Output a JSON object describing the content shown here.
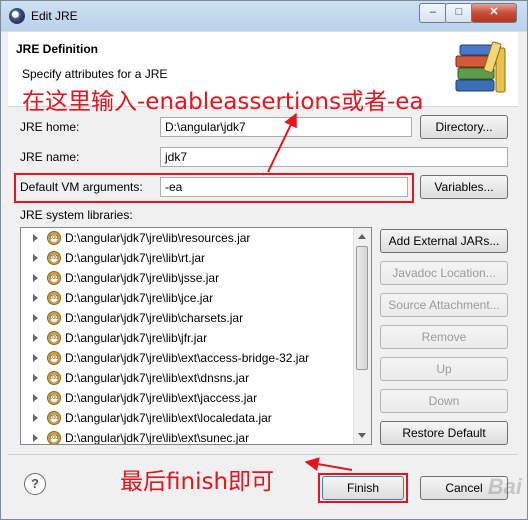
{
  "window": {
    "title": "Edit JRE",
    "minimize_glyph": "–",
    "maximize_glyph": "□",
    "close_glyph": "✕"
  },
  "header": {
    "section_title": "JRE Definition",
    "description": "Specify attributes for a JRE"
  },
  "annotations": {
    "top": "在这里输入-enableassertions或者-ea",
    "bottom": "最后finish即可",
    "color": "#e6141e"
  },
  "form": {
    "jre_home_label": "JRE home:",
    "jre_home_value": "D:\\angular\\jdk7",
    "directory_button": "Directory...",
    "jre_name_label": "JRE name:",
    "jre_name_value": "jdk7",
    "vm_args_label": "Default VM arguments:",
    "vm_args_value": "-ea",
    "variables_button": "Variables..."
  },
  "libraries": {
    "label": "JRE system libraries:",
    "items": [
      "D:\\angular\\jdk7\\jre\\lib\\resources.jar",
      "D:\\angular\\jdk7\\jre\\lib\\rt.jar",
      "D:\\angular\\jdk7\\jre\\lib\\jsse.jar",
      "D:\\angular\\jdk7\\jre\\lib\\jce.jar",
      "D:\\angular\\jdk7\\jre\\lib\\charsets.jar",
      "D:\\angular\\jdk7\\jre\\lib\\jfr.jar",
      "D:\\angular\\jdk7\\jre\\lib\\ext\\access-bridge-32.jar",
      "D:\\angular\\jdk7\\jre\\lib\\ext\\dnsns.jar",
      "D:\\angular\\jdk7\\jre\\lib\\ext\\jaccess.jar",
      "D:\\angular\\jdk7\\jre\\lib\\ext\\localedata.jar",
      "D:\\angular\\jdk7\\jre\\lib\\ext\\sunec.jar"
    ],
    "jar_icon_text": "010",
    "buttons": {
      "add_external": "Add External JARs...",
      "javadoc": "Javadoc Location...",
      "source": "Source Attachment...",
      "remove": "Remove",
      "up": "Up",
      "down": "Down",
      "restore": "Restore Default"
    }
  },
  "footer": {
    "help_glyph": "?",
    "finish": "Finish",
    "cancel": "Cancel",
    "watermark": "Bai"
  }
}
